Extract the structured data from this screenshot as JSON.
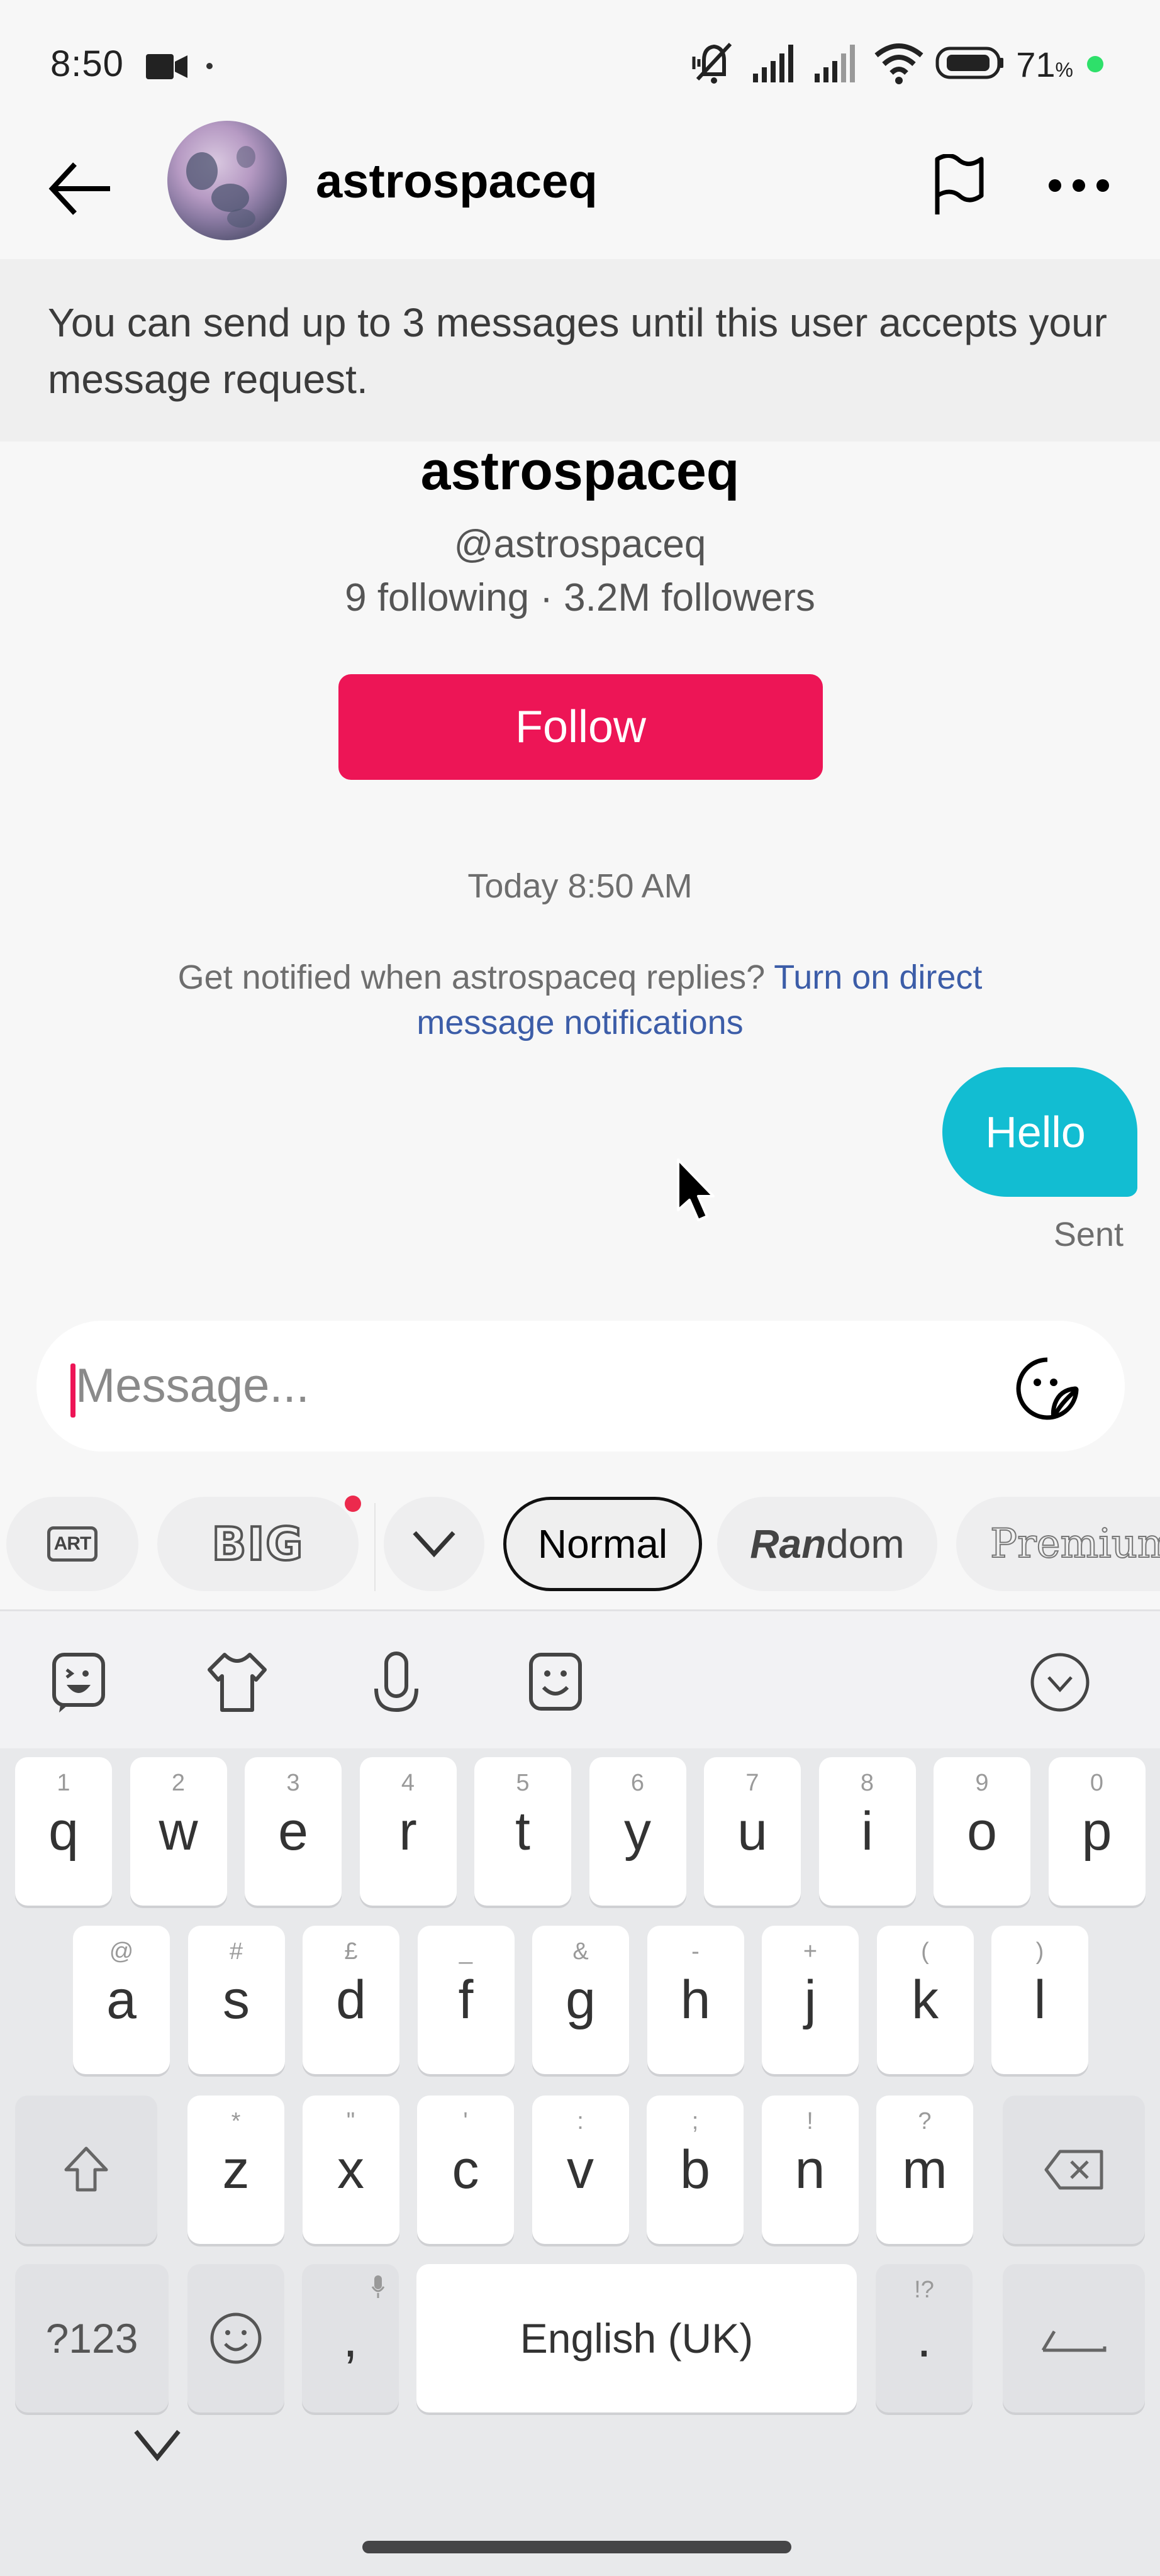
{
  "status_bar": {
    "time": "8:50",
    "battery_percent": "71",
    "battery_unit": "%",
    "icons": [
      "video-camera-icon",
      "notification-dot-icon",
      "mute-icon",
      "signal-icon",
      "signal-icon",
      "wifi-icon",
      "battery-icon",
      "charging-dot-icon"
    ]
  },
  "header": {
    "title": "astrospaceq",
    "back_icon": "arrow-left-icon",
    "flag_icon": "flag-icon",
    "more_icon": "more-horizontal-icon"
  },
  "notice": {
    "text": "You can send up to 3 messages until this user accepts your message request."
  },
  "profile": {
    "name": "astrospaceq",
    "handle": "@astrospaceq",
    "stats": "9 following · 3.2M followers",
    "follow_label": "Follow"
  },
  "conversation": {
    "timestamp": "Today 8:50 AM",
    "notify_prompt": "Get notified when astrospaceq replies? ",
    "notify_link": "Turn on direct message notifications",
    "messages": [
      {
        "text": "Hello",
        "from": "me",
        "status": "Sent"
      }
    ]
  },
  "composer": {
    "placeholder": "Message...",
    "value": "",
    "sticker_icon": "sticker-icon"
  },
  "font_strip": {
    "chips": [
      {
        "label": "ART",
        "kind": "icon"
      },
      {
        "label": "BIG",
        "kind": "icon",
        "badge": true
      },
      {
        "label": "",
        "kind": "expand"
      },
      {
        "label": "Normal",
        "selected": true
      },
      {
        "label_bold": "Ran",
        "label_rest": "dom"
      },
      {
        "label": "Premium"
      }
    ]
  },
  "keyboard": {
    "toolbar": [
      "emoji-keyboard-icon",
      "theme-shirt-icon",
      "microphone-icon",
      "sticker-face-icon",
      "collapse-chevron-icon"
    ],
    "row1": [
      {
        "k": "q",
        "h": "1"
      },
      {
        "k": "w",
        "h": "2"
      },
      {
        "k": "e",
        "h": "3"
      },
      {
        "k": "r",
        "h": "4"
      },
      {
        "k": "t",
        "h": "5"
      },
      {
        "k": "y",
        "h": "6"
      },
      {
        "k": "u",
        "h": "7"
      },
      {
        "k": "i",
        "h": "8"
      },
      {
        "k": "o",
        "h": "9"
      },
      {
        "k": "p",
        "h": "0"
      }
    ],
    "row2": [
      {
        "k": "a",
        "h": "@"
      },
      {
        "k": "s",
        "h": "#"
      },
      {
        "k": "d",
        "h": "£"
      },
      {
        "k": "f",
        "h": "_"
      },
      {
        "k": "g",
        "h": "&"
      },
      {
        "k": "h",
        "h": "-"
      },
      {
        "k": "j",
        "h": "+"
      },
      {
        "k": "k",
        "h": "("
      },
      {
        "k": "l",
        "h": ")"
      }
    ],
    "row3": [
      {
        "k": "z",
        "h": "*"
      },
      {
        "k": "x",
        "h": "\""
      },
      {
        "k": "c",
        "h": "'"
      },
      {
        "k": "v",
        "h": ":"
      },
      {
        "k": "b",
        "h": ";"
      },
      {
        "k": "n",
        "h": "!"
      },
      {
        "k": "m",
        "h": "?"
      }
    ],
    "symbols_label": "?123",
    "comma": ",",
    "space_label": "English (UK)",
    "period": ".",
    "period_hint": "!?"
  },
  "colors": {
    "accent": "#ed1556",
    "bubble": "#12bdd2",
    "link": "#3c5da8"
  }
}
